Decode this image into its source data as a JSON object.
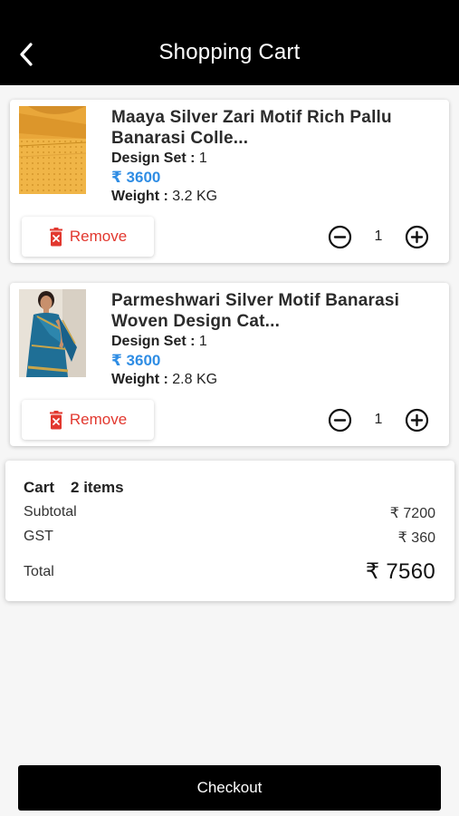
{
  "header": {
    "title": "Shopping Cart",
    "back_icon": "chevron-left-icon"
  },
  "items": [
    {
      "name_line1": "Maaya  Silver Zari Motif Rich Pallu",
      "name_line2": "Banarasi Colle...",
      "design_label": "Design Set :",
      "design_value": "1",
      "price": "₹ 3600",
      "weight_label": "Weight :",
      "weight_value": "3.2 KG",
      "remove_label": "Remove",
      "quantity": "1"
    },
    {
      "name_line1": "Parmeshwari Silver Motif Banarasi",
      "name_line2": "Woven Design Cat...",
      "design_label": "Design Set :",
      "design_value": "1",
      "price": "₹ 3600",
      "weight_label": "Weight :",
      "weight_value": "2.8 KG",
      "remove_label": "Remove",
      "quantity": "1"
    }
  ],
  "summary": {
    "cart_label": "Cart",
    "items_label": "2 items",
    "subtotal_label": "Subtotal",
    "subtotal_value": "₹ 7200",
    "gst_label": "GST",
    "gst_value": "₹ 360",
    "total_label": "Total",
    "total_value": "₹ 7560"
  },
  "checkout_label": "Checkout",
  "colors": {
    "header_bg": "#000000",
    "price": "#2f8de4",
    "remove": "#e2382f",
    "checkout_bg": "#000000"
  }
}
